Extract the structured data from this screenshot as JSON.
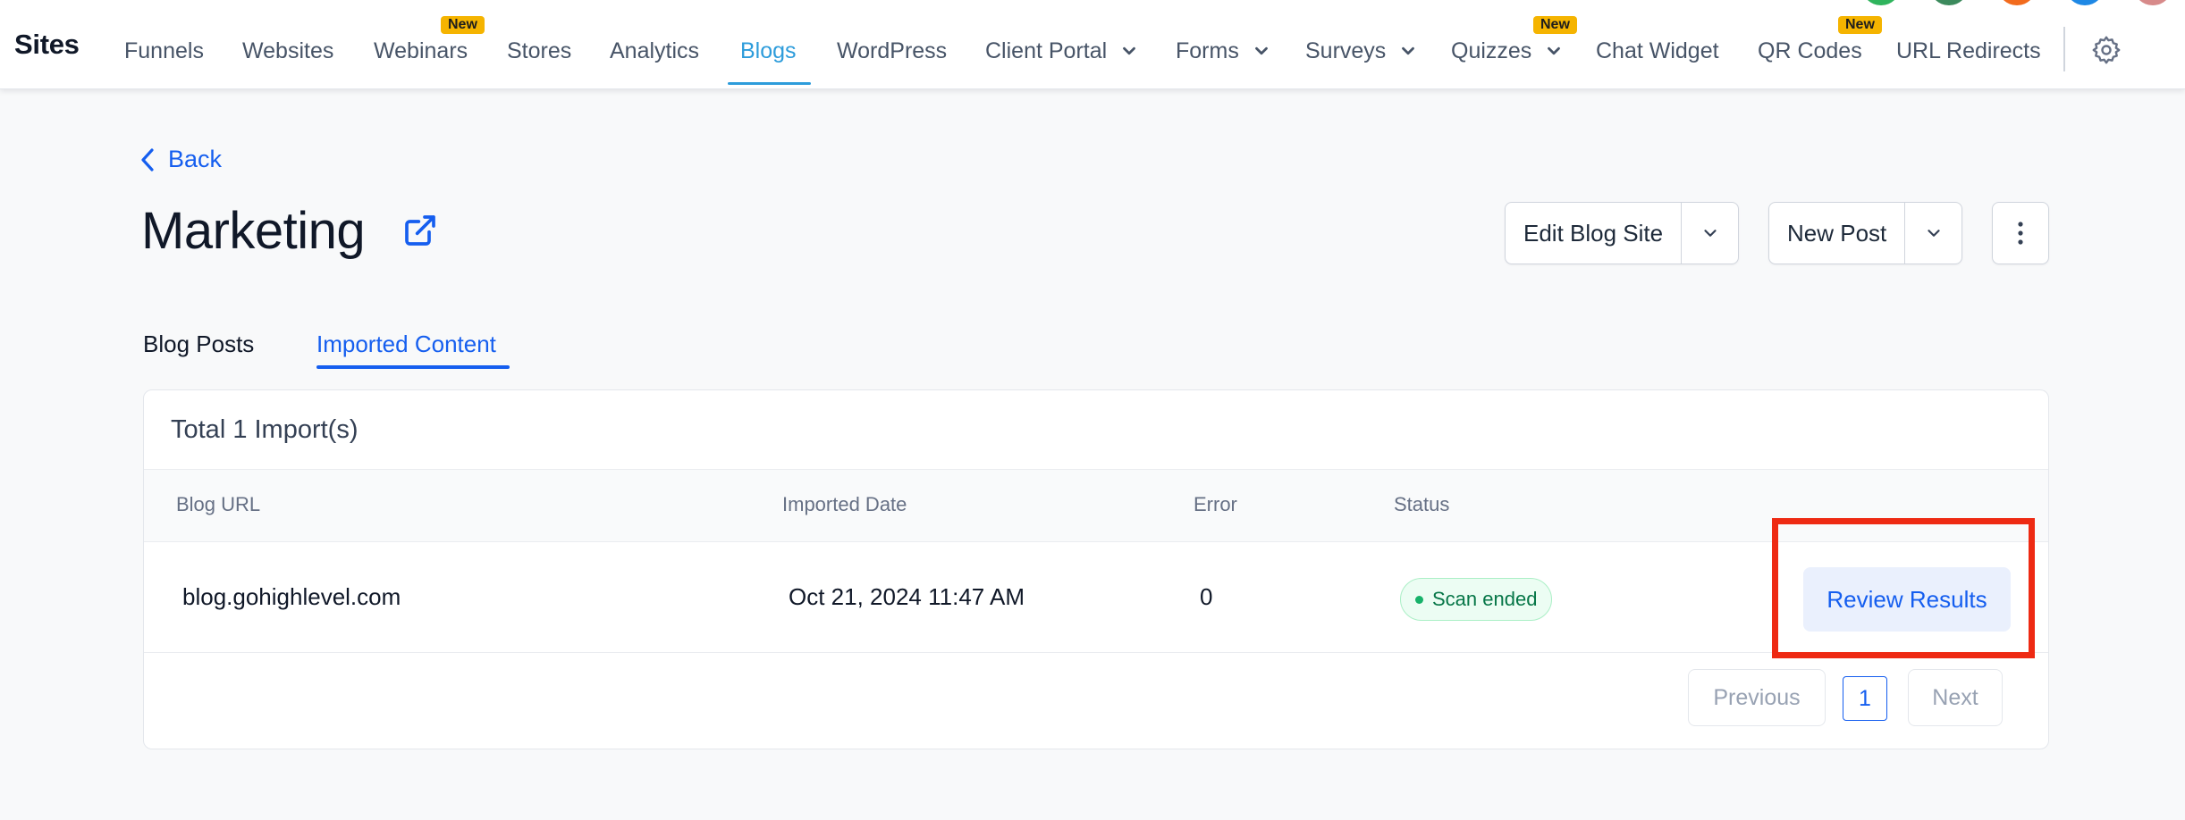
{
  "app": {
    "brand": "Sites"
  },
  "nav": {
    "items": [
      {
        "label": "Funnels"
      },
      {
        "label": "Websites"
      },
      {
        "label": "Webinars",
        "badge": "New"
      },
      {
        "label": "Stores"
      },
      {
        "label": "Analytics"
      },
      {
        "label": "Blogs",
        "active": true
      },
      {
        "label": "WordPress"
      },
      {
        "label": "Client Portal",
        "dropdown": true
      },
      {
        "label": "Forms",
        "dropdown": true
      },
      {
        "label": "Surveys",
        "dropdown": true
      },
      {
        "label": "Quizzes",
        "dropdown": true,
        "badge": "New"
      },
      {
        "label": "Chat Widget"
      },
      {
        "label": "QR Codes",
        "badge": "New"
      },
      {
        "label": "URL Redirects"
      }
    ],
    "settings_icon": "gear-icon",
    "active_color": "#2d9cdb",
    "badge_color": "#f5b400"
  },
  "page": {
    "back_label": "Back",
    "title": "Marketing",
    "actions": {
      "edit_blog_site": "Edit Blog Site",
      "new_post": "New Post"
    }
  },
  "tabs": [
    {
      "label": "Blog Posts",
      "active": false
    },
    {
      "label": "Imported Content",
      "active": true
    }
  ],
  "imports": {
    "total_label": "Total 1 Import(s)",
    "columns": [
      "Blog URL",
      "Imported Date",
      "Error",
      "Status"
    ],
    "rows": [
      {
        "blog_url": "blog.gohighlevel.com",
        "imported_date": "Oct 21, 2024 11:47 AM",
        "error": "0",
        "status": "Scan ended",
        "action": "Review Results"
      }
    ],
    "pagination": {
      "previous": "Previous",
      "current": "1",
      "next": "Next"
    }
  },
  "colors": {
    "primary": "#155eef",
    "status_success": "#067647",
    "highlight": "#ee2a13"
  }
}
